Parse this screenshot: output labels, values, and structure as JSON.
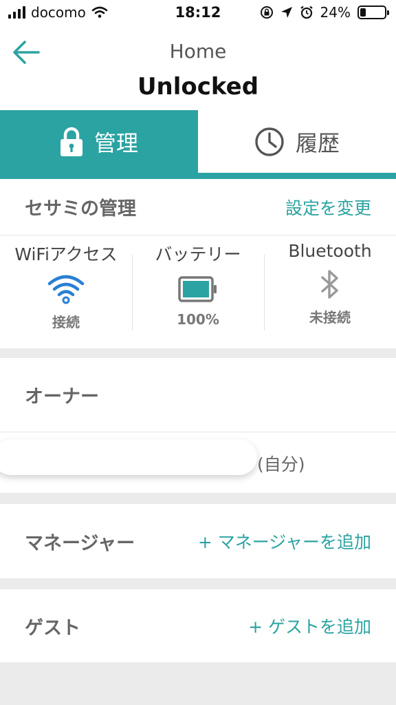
{
  "status_bar": {
    "carrier": "docomo",
    "time": "18:12",
    "battery_percent": "24%",
    "battery_level": 0.24
  },
  "header": {
    "subtitle": "Home",
    "title": "Unlocked"
  },
  "tabs": [
    {
      "label": "管理",
      "icon": "lock-icon",
      "active": true
    },
    {
      "label": "履歴",
      "icon": "clock-icon",
      "active": false
    }
  ],
  "management": {
    "title": "セサミの管理",
    "change_settings": "設定を変更"
  },
  "status_items": [
    {
      "label": "WiFiアクセス",
      "value": "接続",
      "icon": "wifi-icon"
    },
    {
      "label": "バッテリー",
      "value": "100%",
      "icon": "battery-icon"
    },
    {
      "label": "Bluetooth",
      "value": "未接続",
      "icon": "bluetooth-icon"
    }
  ],
  "owner": {
    "title": "オーナー",
    "self_label": "(自分)"
  },
  "manager": {
    "title": "マネージャー",
    "add_label": "+ マネージャーを追加"
  },
  "guest": {
    "title": "ゲスト",
    "add_label": "+ ゲストを追加"
  },
  "colors": {
    "accent": "#2ba3a2",
    "wifi": "#2a7fd4",
    "gap": "#ebebeb"
  }
}
